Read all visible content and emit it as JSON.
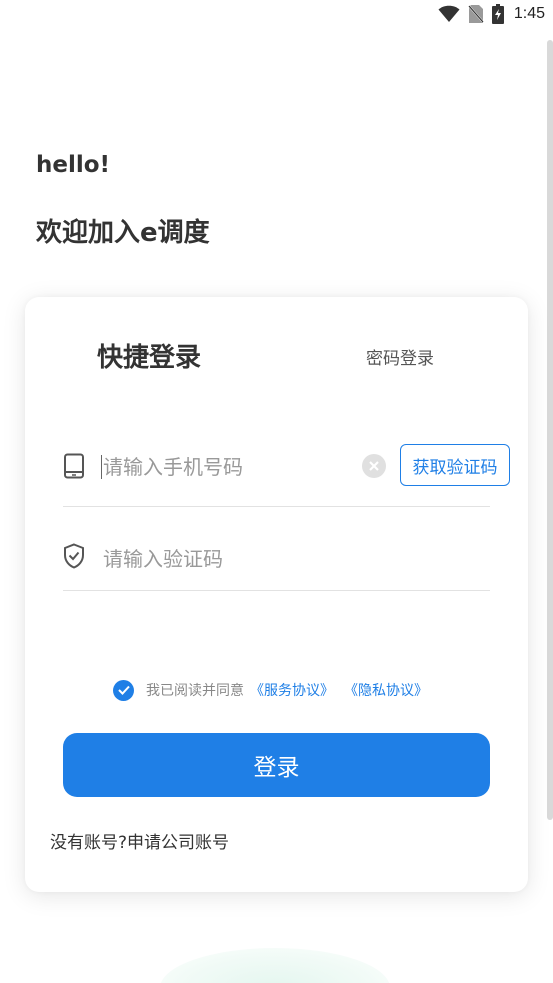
{
  "status_bar": {
    "time": "1:45",
    "icons": [
      "wifi-icon",
      "no-sim-icon",
      "battery-charging-icon"
    ]
  },
  "greeting": {
    "hello": "hello!",
    "welcome": "欢迎加入e调度"
  },
  "tabs": {
    "quick_login": "快捷登录",
    "password_login": "密码登录"
  },
  "phone_field": {
    "value": "",
    "placeholder": "请输入手机号码",
    "icon": "phone-icon"
  },
  "get_code_button": "获取验证码",
  "code_field": {
    "value": "",
    "placeholder": "请输入验证码",
    "icon": "shield-icon"
  },
  "agreement": {
    "checked": true,
    "prefix": "我已阅读并同意",
    "service": "《服务协议》",
    "privacy": "《隐私协议》"
  },
  "login_button": "登录",
  "apply_account": "没有账号?申请公司账号",
  "colors": {
    "primary": "#1f7fe6",
    "text": "#333333",
    "placeholder": "#999999"
  }
}
